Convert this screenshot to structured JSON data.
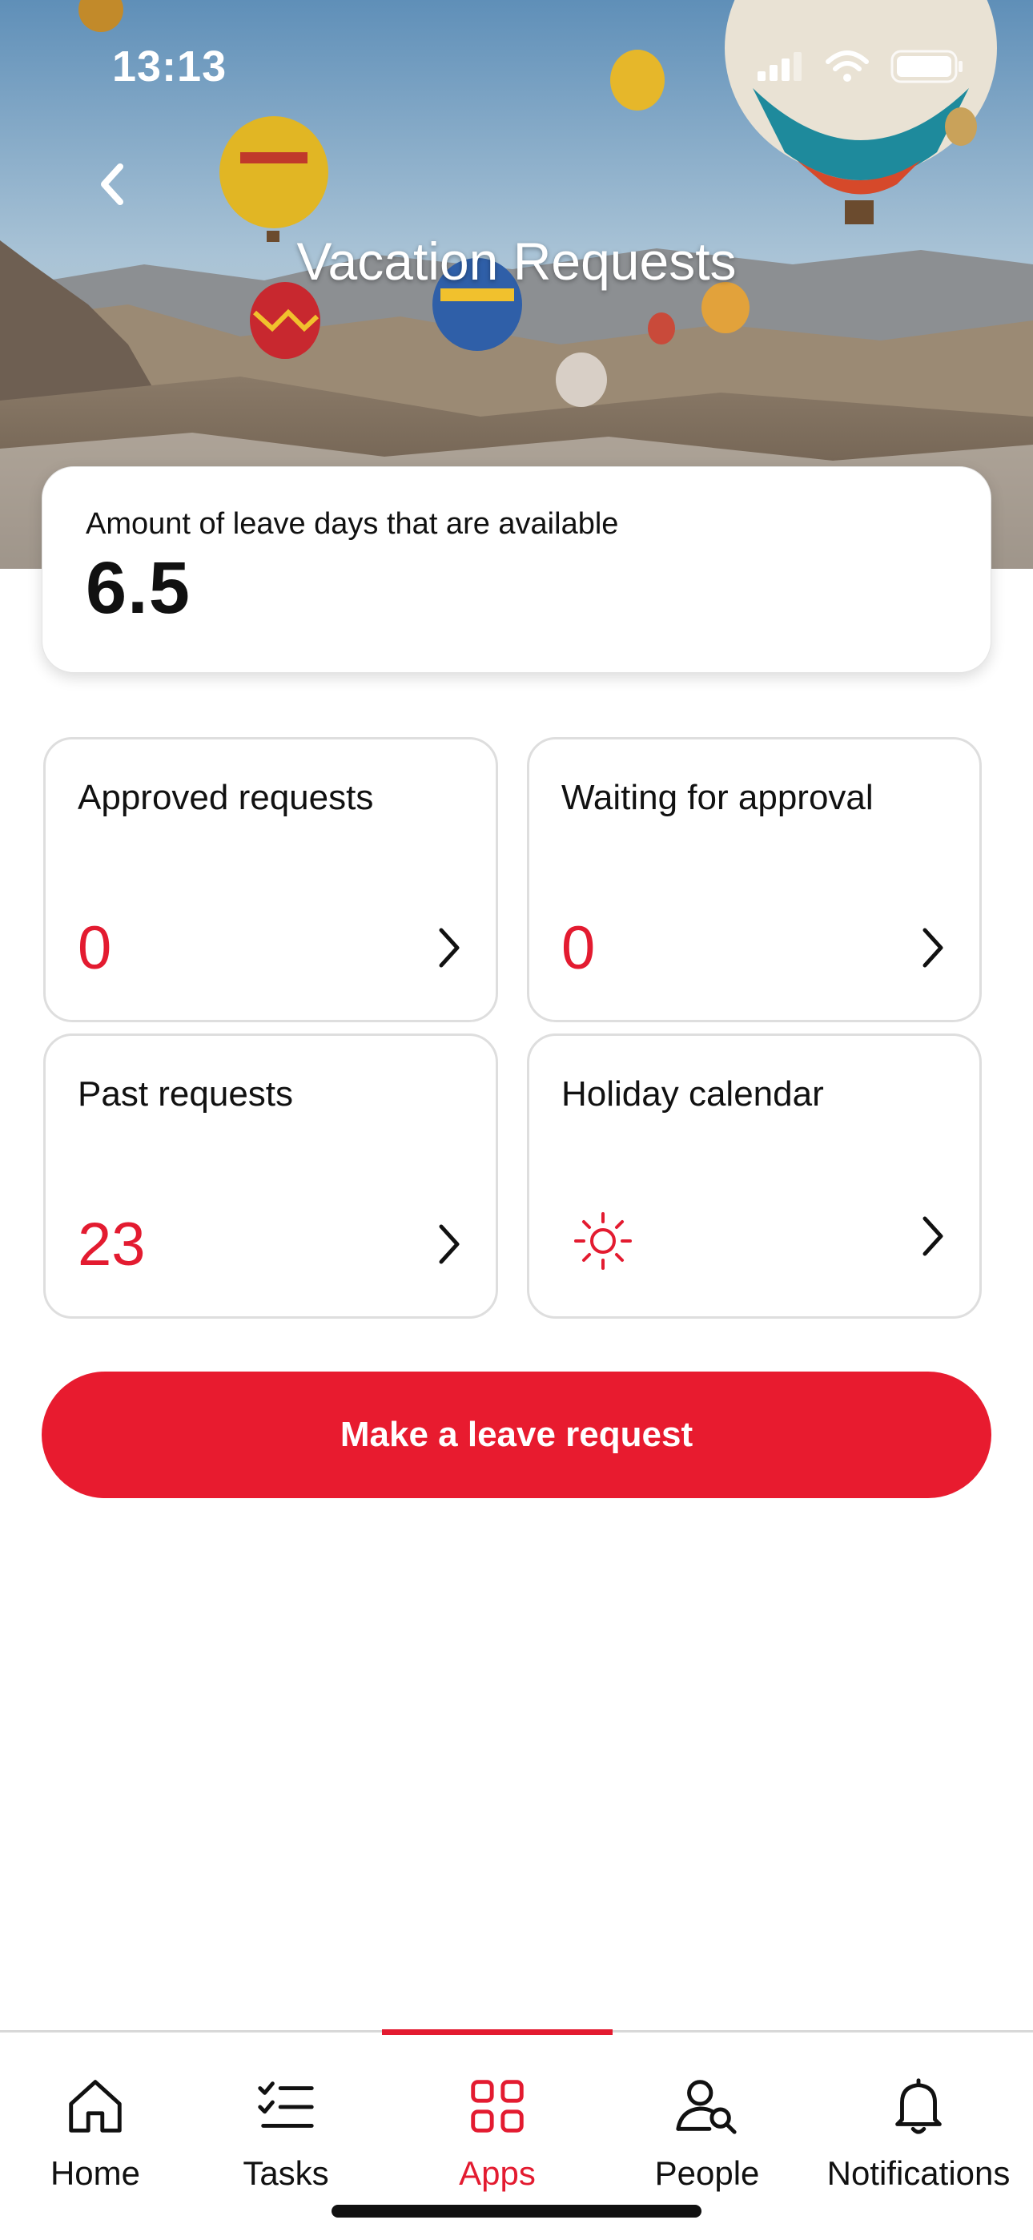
{
  "status_bar": {
    "time": "13:13",
    "icons": [
      "cellular-signal-icon",
      "wifi-icon",
      "battery-icon"
    ]
  },
  "header": {
    "title": "Vacation Requests",
    "back_icon": "chevron-left-icon",
    "background": "hot-air-balloons-landscape"
  },
  "balance": {
    "label": "Amount of leave days that are available",
    "value": "6.5"
  },
  "tiles": [
    {
      "title": "Approved requests",
      "count": "0",
      "icon": "chevron-right-icon"
    },
    {
      "title": "Waiting for approval",
      "count": "0",
      "icon": "chevron-right-icon"
    },
    {
      "title": "Past requests",
      "count": "23",
      "icon": "chevron-right-icon"
    },
    {
      "title": "Holiday calendar",
      "icon": "sun-icon"
    }
  ],
  "primary_action": {
    "label": "Make a leave request"
  },
  "bottom_nav": {
    "active": "Apps",
    "items": [
      {
        "label": "Home",
        "icon": "home-icon"
      },
      {
        "label": "Tasks",
        "icon": "tasks-icon"
      },
      {
        "label": "Apps",
        "icon": "apps-grid-icon"
      },
      {
        "label": "People",
        "icon": "people-search-icon"
      },
      {
        "label": "Notifications",
        "icon": "bell-icon"
      }
    ]
  },
  "colors": {
    "accent": "#e31b30",
    "button": "#e81b2f",
    "text": "#111111"
  }
}
